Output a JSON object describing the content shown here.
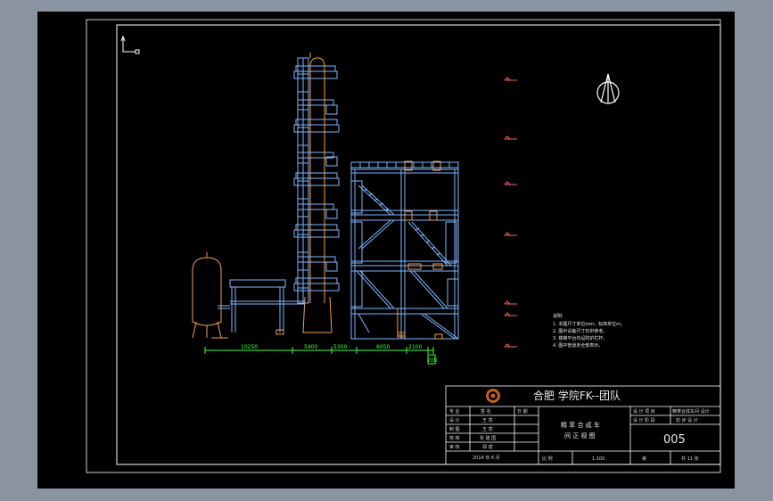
{
  "title_block": {
    "school": "合肥 学院FK--团队",
    "drawing_title_line1": "精 苯 合 成 车",
    "drawing_title_line2": "间 正 视 图",
    "drawing_number": "005",
    "scale_label": "比 例",
    "scale_value": "1:100",
    "sheet_no_label": "第",
    "sheet_total_label": "共 11 张",
    "roles": [
      "设 计",
      "制 图",
      "校 核",
      "审 核"
    ],
    "role_names": [
      "王 亮",
      "王 亮",
      "张 建 国",
      "郑 斌"
    ],
    "header_left": [
      "专 业",
      "签 名",
      "日 期"
    ],
    "project_labels": [
      "设 计 项 目",
      "设 计 阶 段"
    ],
    "project_values": [
      "精苯合成车间 设计",
      "初 步 设 计"
    ],
    "date_row": "2014 年 6 月"
  },
  "dimensions": [
    "10250",
    "5400",
    "5300",
    "6050",
    "2100",
    "200"
  ],
  "notes": {
    "heading": "说明:",
    "items": [
      "1. 本图尺寸单位mm，标高单位m。",
      "2. 图中设备尺寸仅供参考。",
      "3. 楼梯平台均设防护栏杆。",
      "4. 图中管道未全部表示。"
    ]
  },
  "colors": {
    "frame": "#ffffff",
    "structure": "#7fb6ff",
    "equipment": "#f0a050",
    "dimension": "#3cff3c",
    "annotation": "#ff6060",
    "title_text": "#e8e8e8",
    "logo": "#c06020"
  },
  "icons": [
    "north-arrow-icon",
    "ucs-axis-icon",
    "school-logo-icon"
  ]
}
